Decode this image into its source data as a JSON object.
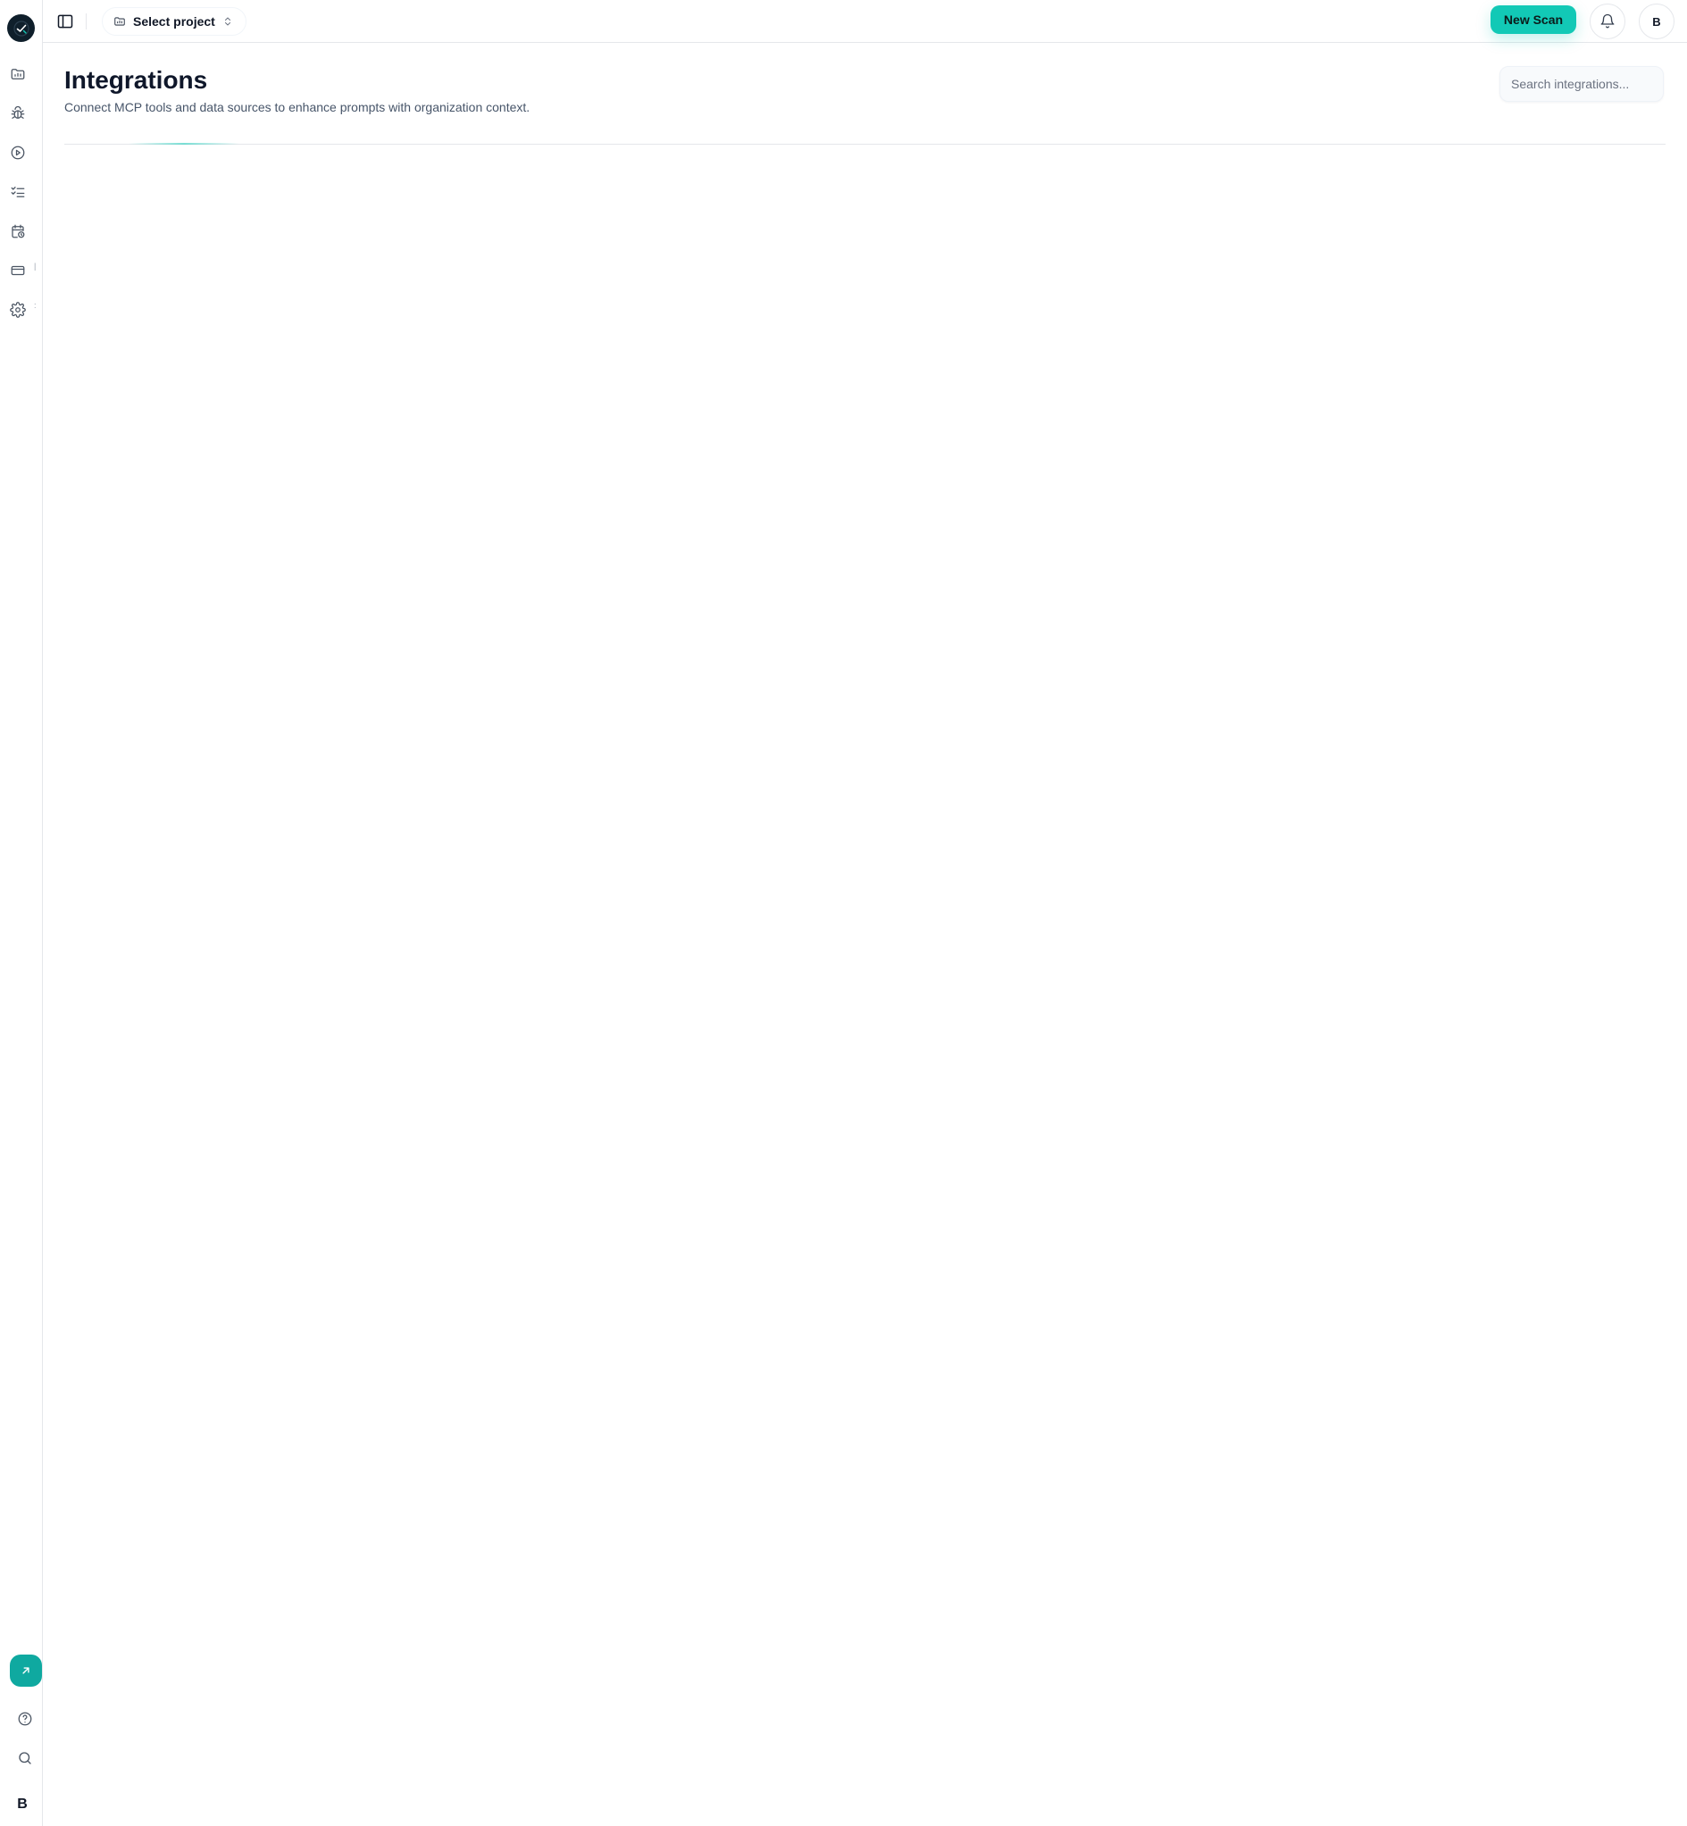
{
  "topbar": {
    "project_select_label": "Select project",
    "new_scan_label": "New Scan",
    "avatar_initial": "B"
  },
  "page": {
    "title": "Integrations",
    "subtitle": "Connect MCP tools and data sources to enhance prompts with organization context.",
    "search_placeholder": "Search integrations..."
  },
  "sidebar": {
    "items": [
      {
        "icon": "folder-chart-icon"
      },
      {
        "icon": "bug-icon"
      },
      {
        "icon": "play-circle-icon"
      },
      {
        "icon": "checklist-icon"
      },
      {
        "icon": "calendar-clock-icon"
      },
      {
        "icon": "credit-card-icon"
      },
      {
        "icon": "gear-icon"
      }
    ],
    "bottom": {
      "launch_icon": "arrow-up-right-icon",
      "help_icon": "help-circle-icon",
      "search_icon": "search-icon",
      "avatar_initial": "B"
    }
  },
  "colors": {
    "accent": "#12c9b6",
    "launch_accent": "#0fa9a0",
    "logo_bg": "#0f1f2b",
    "border": "#e5e7eb",
    "title": "#0f172a",
    "subtitle": "#475569"
  }
}
